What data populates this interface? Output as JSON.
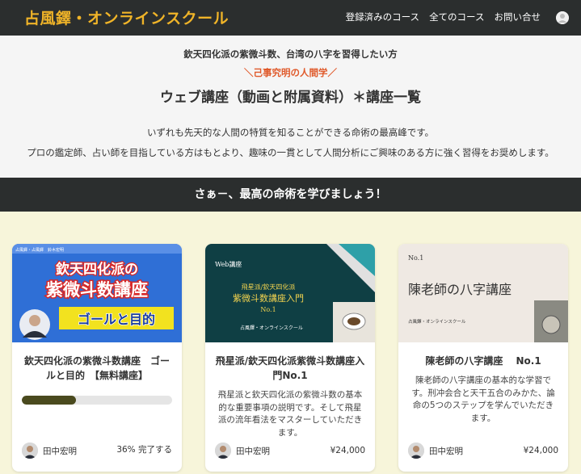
{
  "header": {
    "logo": "占風鐸・オンラインスクール",
    "nav": [
      "登録済みのコース",
      "全てのコース",
      "お問い合せ"
    ]
  },
  "hero": {
    "subtitle": "欽天四化派の紫微斗数、台湾の八字を習得したい方",
    "tagline": "＼己事究明の人間学／",
    "title": "ウェブ講座（動画と附属資料）＊講座一覧",
    "paragraph1": "いずれも先天的な人間の特質を知ることができる命術の最高峰です。",
    "paragraph2": "プロの鑑定師、占い師を目指している方はもとより、趣味の一貫として人間分析にご興味のある方に強く習得をお奨めします。"
  },
  "banner": "さぁ－、最高の命術を学びましょう！",
  "courses": [
    {
      "thumb": {
        "line1": "欽天四化派の",
        "line2": "紫微斗数講座",
        "line3": "ゴールと目的",
        "corner": "占風鐸・占風鐸　鈴木宏明"
      },
      "title": "欽天四化派の紫微斗数講座　ゴールと目的　【無料講座】",
      "progress": 36,
      "author": "田中宏明",
      "status": "36% 完了する"
    },
    {
      "thumb": {
        "tag": "Web講座",
        "line1": "飛星派/欽天四化派",
        "line2": "紫微斗数講座入門",
        "line3": "No.1",
        "brand": "占風鐸・オンラインスクール"
      },
      "title": "飛星派/欽天四化派紫微斗数講座入門No.1",
      "description": "飛星派と欽天四化派の紫微斗数の基本的な重要事項の説明です。そして飛星派の流年看法をマスターしていただきます。",
      "author": "田中宏明",
      "price": "¥24,000"
    },
    {
      "thumb": {
        "tag": "No.1",
        "line1": "陳老師の八字講座",
        "brand": "占風鐸・オンラインスクール"
      },
      "title": "陳老師の八字講座　 No.1",
      "description": "陳老師の八字講座の基本的な学習です。刑冲会合と天干五合のみかた、論命の5つのステップを学んでいただきます。",
      "author": "田中宏明",
      "price": "¥24,000"
    }
  ]
}
